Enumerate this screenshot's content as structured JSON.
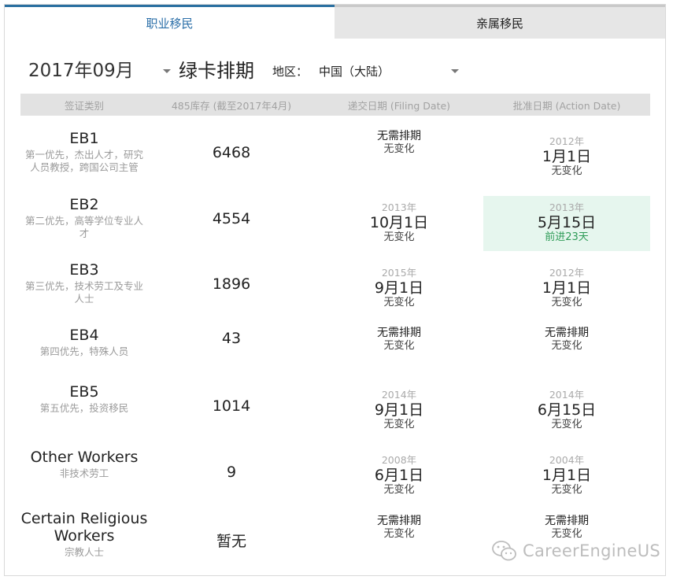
{
  "tabs": [
    {
      "label": "职业移民",
      "active": true
    },
    {
      "label": "亲属移民",
      "active": false
    }
  ],
  "controls": {
    "month": "2017年09月",
    "title": "绿卡排期",
    "region_label": "地区：",
    "region": "中国（大陆）"
  },
  "table": {
    "headers": [
      "签证类别",
      "485库存 (截至2017年4月)",
      "递交日期 (Filing Date)",
      "批准日期 (Action Date)"
    ],
    "rows": [
      {
        "code": "EB1",
        "desc": "第一优先，杰出人才，研究人员教授，跨国公司主管",
        "count": "6468",
        "filing": {
          "year": "",
          "date": "",
          "none": "无需排期",
          "change": "无变化"
        },
        "action": {
          "year": "2012年",
          "date": "1月1日",
          "none": "",
          "change": "无变化"
        }
      },
      {
        "code": "EB2",
        "desc": "第二优先，高等学位专业人才",
        "count": "4554",
        "filing": {
          "year": "2013年",
          "date": "10月1日",
          "none": "",
          "change": "无变化"
        },
        "action": {
          "year": "2013年",
          "date": "5月15日",
          "none": "",
          "change": "前进23天",
          "highlight": true
        }
      },
      {
        "code": "EB3",
        "desc": "第三优先，技术劳工及专业人士",
        "count": "1896",
        "filing": {
          "year": "2015年",
          "date": "9月1日",
          "none": "",
          "change": "无变化"
        },
        "action": {
          "year": "2012年",
          "date": "1月1日",
          "none": "",
          "change": "无变化"
        }
      },
      {
        "code": "EB4",
        "desc": "第四优先，特殊人员",
        "count": "43",
        "filing": {
          "year": "",
          "date": "",
          "none": "无需排期",
          "change": "无变化"
        },
        "action": {
          "year": "",
          "date": "",
          "none": "无需排期",
          "change": "无变化"
        }
      },
      {
        "code": "EB5",
        "desc": "第五优先，投资移民",
        "count": "1014",
        "filing": {
          "year": "2014年",
          "date": "9月1日",
          "none": "",
          "change": "无变化"
        },
        "action": {
          "year": "2014年",
          "date": "6月15日",
          "none": "",
          "change": "无变化"
        }
      },
      {
        "code": "Other Workers",
        "desc": "非技术劳工",
        "count": "9",
        "filing": {
          "year": "2008年",
          "date": "6月1日",
          "none": "",
          "change": "无变化"
        },
        "action": {
          "year": "2004年",
          "date": "1月1日",
          "none": "",
          "change": "无变化"
        }
      },
      {
        "code": "Certain Religious Workers",
        "desc": "宗教人士",
        "count": "暂无",
        "filing": {
          "year": "",
          "date": "",
          "none": "无需排期",
          "change": "无变化"
        },
        "action": {
          "year": "",
          "date": "",
          "none": "无需排期",
          "change": "无变化"
        }
      }
    ]
  },
  "watermark": {
    "text": "CareerEngineUS",
    "icon": "wechat-icon"
  },
  "colors": {
    "accent": "#2b6fa8",
    "advance": "#2e9b57",
    "highlight_bg": "#e6f6ee",
    "header_bg": "#e2e2e2"
  }
}
